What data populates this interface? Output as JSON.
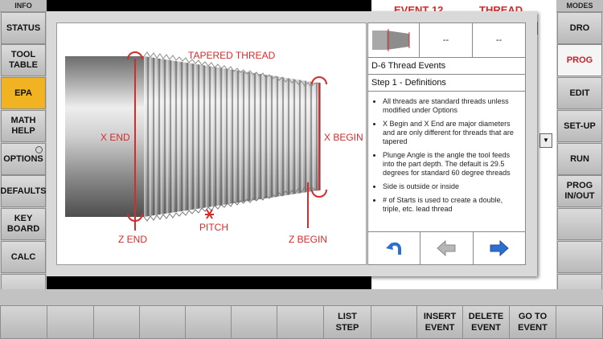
{
  "left_sidebar": {
    "header": "INFO",
    "items": [
      "STATUS",
      "TOOL\nTABLE",
      "EPA",
      "MATH\nHELP",
      "OPTIONS",
      "DEFAULTS",
      "KEY\nBOARD",
      "CALC"
    ]
  },
  "right_sidebar": {
    "header": "MODES",
    "items": [
      "DRO",
      "PROG",
      "EDIT",
      "SET-UP",
      "RUN",
      "PROG\nIN/OUT"
    ]
  },
  "background": {
    "event_label": "EVENT 12",
    "event_type": "THREAD"
  },
  "figure": {
    "tapered_thread": "TAPERED THREAD",
    "x_end": "X END",
    "x_begin": "X BEGIN",
    "z_end": "Z END",
    "pitch": "PITCH",
    "z_begin": "Z BEGIN"
  },
  "help_panel": {
    "thumb_2": "--",
    "thumb_3": "--",
    "title": "D-6 Thread Events",
    "step": "Step 1 - Definitions",
    "bullets": [
      "All threads are standard threads unless modified under Options",
      "X Begin and X End are major diameters and are only different for threads that are tapered",
      "Plunge Angle is the angle the tool feeds into the part depth. The default is 29.5 degrees for standard 60 degree threads",
      "Side is outside or inside",
      "# of Starts is used to create a double, triple, etc. lead thread"
    ]
  },
  "softkeys": [
    "",
    "",
    "",
    "LIST\nSTEP",
    "",
    "INSERT\nEVENT",
    "DELETE\nEVENT",
    "GO TO\nEVENT"
  ],
  "colors": {
    "active_tab": "#f1b321",
    "annotation_red": "#d42b2b",
    "nav_blue": "#2d6fd1"
  }
}
